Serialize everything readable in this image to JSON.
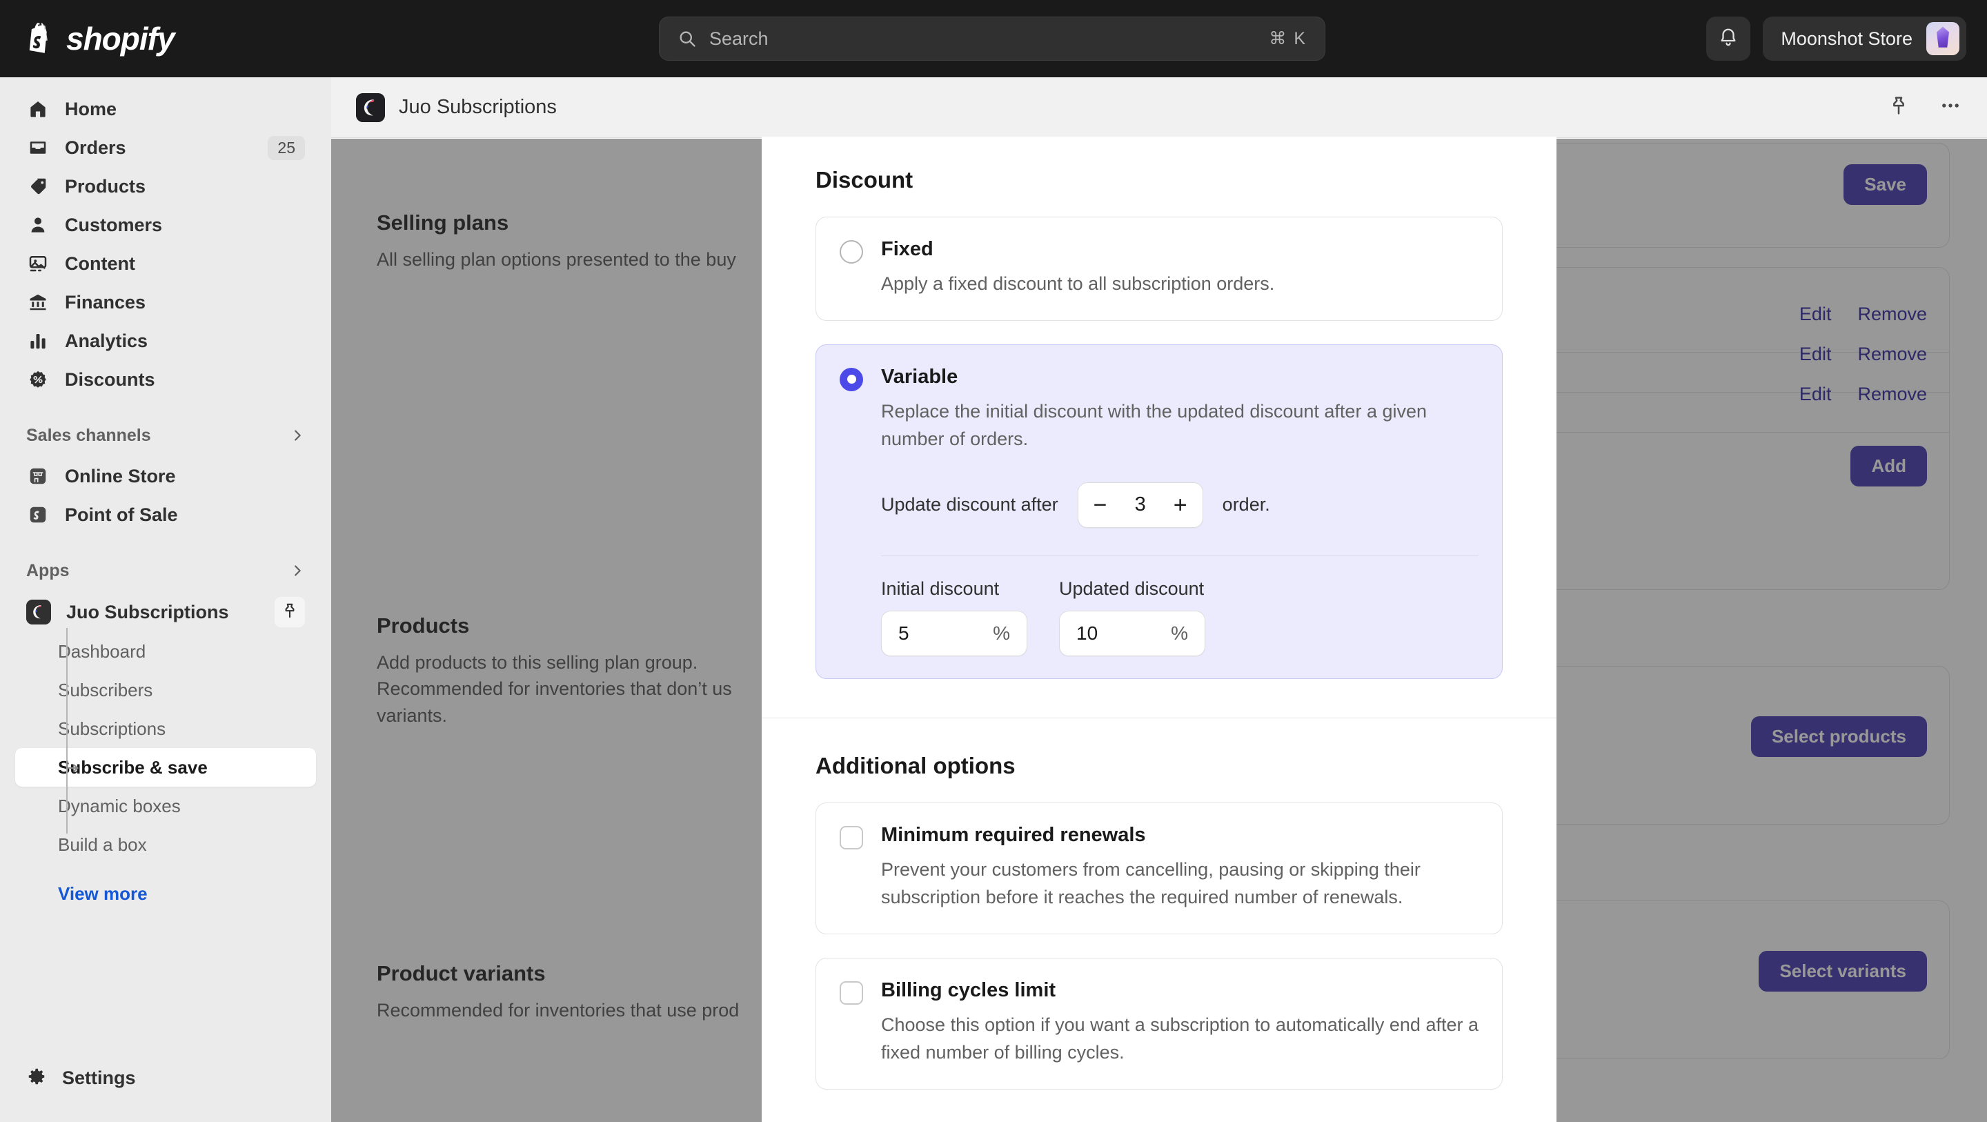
{
  "topbar": {
    "brand": "shopify",
    "search": {
      "placeholder": "Search",
      "shortcut": "⌘ K"
    },
    "notifications_icon": "bell-icon",
    "store_name": "Moonshot Store"
  },
  "sidebar": {
    "items": [
      {
        "label": "Home",
        "icon": "home-icon",
        "badge": ""
      },
      {
        "label": "Orders",
        "icon": "orders-icon",
        "badge": "25"
      },
      {
        "label": "Products",
        "icon": "tag-icon",
        "badge": ""
      },
      {
        "label": "Customers",
        "icon": "person-icon",
        "badge": ""
      },
      {
        "label": "Content",
        "icon": "image-icon",
        "badge": ""
      },
      {
        "label": "Finances",
        "icon": "bank-icon",
        "badge": ""
      },
      {
        "label": "Analytics",
        "icon": "bar-chart-icon",
        "badge": ""
      },
      {
        "label": "Discounts",
        "icon": "discount-icon",
        "badge": ""
      }
    ],
    "sales_channels": {
      "heading": "Sales channels",
      "items": [
        {
          "label": "Online Store",
          "icon": "store-icon"
        },
        {
          "label": "Point of Sale",
          "icon": "pos-icon"
        }
      ]
    },
    "apps": {
      "heading": "Apps",
      "app_name": "Juo Subscriptions",
      "pin_icon": "pin-icon",
      "sub_items": [
        {
          "label": "Dashboard",
          "active": false
        },
        {
          "label": "Subscribers",
          "active": false
        },
        {
          "label": "Subscriptions",
          "active": false
        },
        {
          "label": "Subscribe & save",
          "active": true
        },
        {
          "label": "Dynamic boxes",
          "active": false
        },
        {
          "label": "Build a box",
          "active": false
        }
      ],
      "view_more": "View more"
    },
    "settings": {
      "label": "Settings",
      "icon": "gear-icon"
    }
  },
  "app_header": {
    "title": "Juo Subscriptions",
    "pin_icon": "pin-icon",
    "more_icon": "ellipsis-icon"
  },
  "background_page": {
    "save_label": "Save",
    "sections": [
      {
        "title": "Selling plans",
        "subtitle": "All selling plan options presented to the buy"
      },
      {
        "title": "Products",
        "subtitle": "Add products to this selling plan group. Recommended for inventories that don’t us variants."
      },
      {
        "title": "Product variants",
        "subtitle": "Recommended for inventories that use prod"
      }
    ],
    "plan_rows": [
      {
        "edit": "Edit",
        "remove": "Remove"
      },
      {
        "edit": "Edit",
        "remove": "Remove"
      },
      {
        "edit": "Edit",
        "remove": "Remove"
      }
    ],
    "add_label": "Add",
    "select_products_label": "Select products",
    "select_variants_label": "Select variants"
  },
  "modal": {
    "discount": {
      "heading": "Discount",
      "options": [
        {
          "id": "fixed",
          "label": "Fixed",
          "description": "Apply a fixed discount to all subscription orders.",
          "selected": false
        },
        {
          "id": "variable",
          "label": "Variable",
          "description": "Replace the initial discount with the updated discount after a given number of orders.",
          "selected": true
        }
      ],
      "variable_settings": {
        "update_after_label": "Update discount after",
        "update_after_value": "3",
        "update_after_suffix": "order.",
        "decrement_icon": "minus-icon",
        "increment_icon": "plus-icon",
        "initial_discount_label": "Initial discount",
        "initial_discount_value": "5",
        "initial_discount_unit": "%",
        "updated_discount_label": "Updated discount",
        "updated_discount_value": "10",
        "updated_discount_unit": "%"
      }
    },
    "additional_options": {
      "heading": "Additional options",
      "options": [
        {
          "label": "Minimum required renewals",
          "description": "Prevent your customers from cancelling, pausing or skipping their subscription before it reaches the required number of renewals.",
          "checked": false
        },
        {
          "label": "Billing cycles limit",
          "description": "Choose this option if you want a subscription to automatically end after a fixed number of billing cycles.",
          "checked": false
        }
      ]
    }
  },
  "colors": {
    "accent_indigo": "#4b4ae8",
    "primary_button": "#4f46b5",
    "link_blue": "#1558d6",
    "topbar_bg": "#1a1a1a",
    "sidebar_bg": "#ebebeb"
  }
}
